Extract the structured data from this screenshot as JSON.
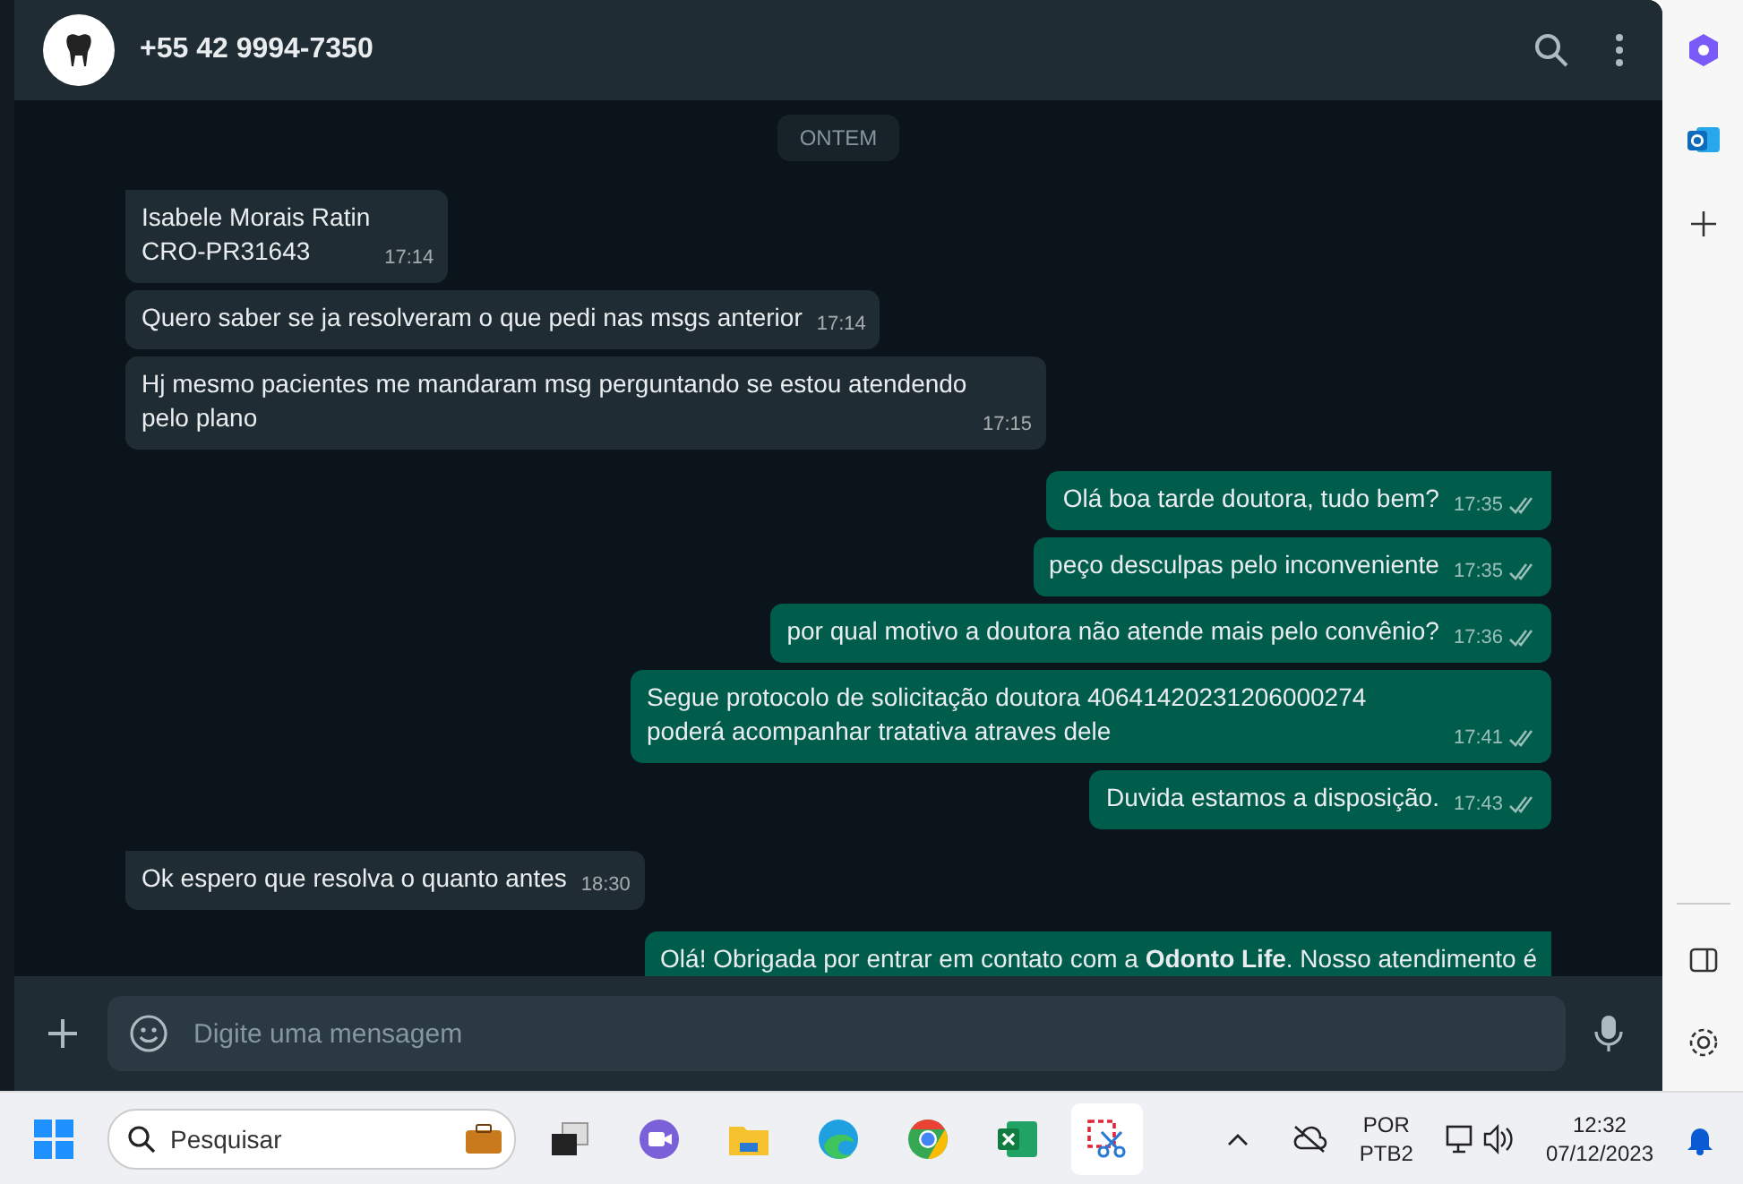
{
  "header": {
    "title": "+55 42 9994-7350"
  },
  "date_chip": "ONTEM",
  "messages": [
    {
      "kind": "incoming",
      "lines": [
        "Isabele Morais Ratin",
        "CRO-PR31643"
      ],
      "time": "17:14",
      "tail": true
    },
    {
      "kind": "incoming",
      "lines": [
        "Quero saber se ja resolveram o que pedi nas msgs anterior"
      ],
      "time": "17:14",
      "tail": false
    },
    {
      "kind": "incoming",
      "lines": [
        "Hj mesmo pacientes me mandaram msg perguntando se estou atendendo pelo plano"
      ],
      "time": "17:15",
      "tail": false
    },
    {
      "kind": "outgoing",
      "lines": [
        "Olá boa tarde doutora, tudo bem?"
      ],
      "time": "17:35",
      "tail": true,
      "read": false
    },
    {
      "kind": "outgoing",
      "lines": [
        "peço desculpas pelo inconveniente"
      ],
      "time": "17:35",
      "tail": false,
      "read": false
    },
    {
      "kind": "outgoing",
      "lines": [
        "por qual motivo a doutora não atende mais pelo convênio?"
      ],
      "time": "17:36",
      "tail": false,
      "read": false
    },
    {
      "kind": "outgoing",
      "lines": [
        "Segue protocolo de solicitação doutora 40641420231206000274 poderá acompanhar tratativa atraves dele"
      ],
      "time": "17:41",
      "tail": false,
      "read": false
    },
    {
      "kind": "outgoing",
      "lines": [
        "Duvida estamos a disposição."
      ],
      "time": "17:43",
      "tail": false,
      "read": false
    },
    {
      "kind": "incoming",
      "lines": [
        "Ok espero que resolva o quanto antes"
      ],
      "time": "18:30",
      "tail": true
    },
    {
      "kind": "outgoing",
      "lines": [
        "Olá! Obrigada por entrar em contato com a **Odonto Life**. Nosso atendimento é"
      ],
      "tail": true
    }
  ],
  "composer": {
    "placeholder": "Digite uma mensagem"
  },
  "taskbar": {
    "search_placeholder": "Pesquisar",
    "language": "POR",
    "layout": "PTB2",
    "time": "12:32",
    "date": "07/12/2023"
  }
}
